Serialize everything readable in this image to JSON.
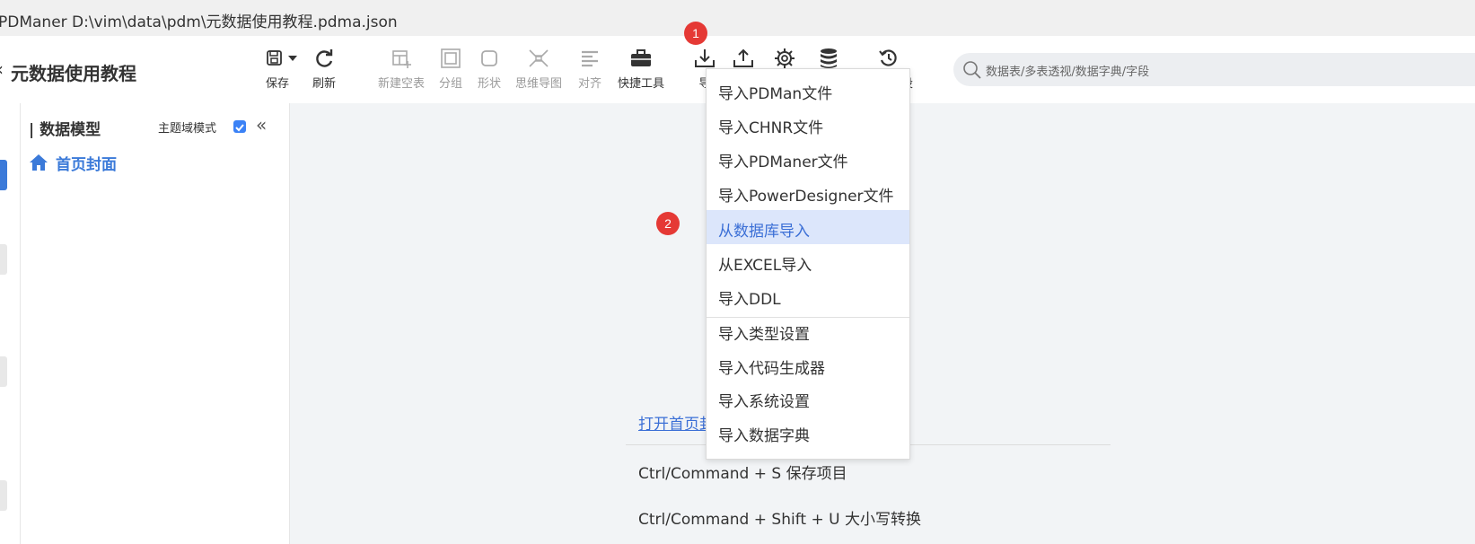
{
  "window": {
    "title": "PDManer  D:\\vim\\data\\pdm\\元数据使用教程.pdma.json"
  },
  "project": {
    "title": "元数据使用教程"
  },
  "toolbar": {
    "save": "保存",
    "refresh": "刷新",
    "new_table": "新建空表",
    "group": "分组",
    "shape": "形状",
    "mindmap": "思维导图",
    "align": "对齐",
    "quick_tools": "快捷工具",
    "import_partial": "导",
    "version_partial": "设"
  },
  "badges": {
    "one": "1",
    "two": "2"
  },
  "search": {
    "placeholder": "数据表/多表透视/数据字典/字段"
  },
  "sidebar": {
    "title": "| 数据模型",
    "mode_label": "主题域模式",
    "mode_checked": true,
    "collapse": "«",
    "home": "首页封面"
  },
  "main": {
    "open_link": "打开首页封",
    "shortcuts": [
      "Ctrl/Command + S 保存项目",
      "Ctrl/Command + Shift + U 大小写转换"
    ]
  },
  "import_menu": {
    "items": [
      "导入PDMan文件",
      "导入CHNR文件",
      "导入PDManer文件",
      "导入PowerDesigner文件",
      "从数据库导入",
      "从EXCEL导入",
      "导入DDL",
      "导入类型设置",
      "导入代码生成器",
      "导入系统设置",
      "导入数据字典"
    ],
    "active_index": 4
  },
  "colors": {
    "accent": "#3b7ad9",
    "badge": "#e53935",
    "highlight": "#dce6fb"
  }
}
